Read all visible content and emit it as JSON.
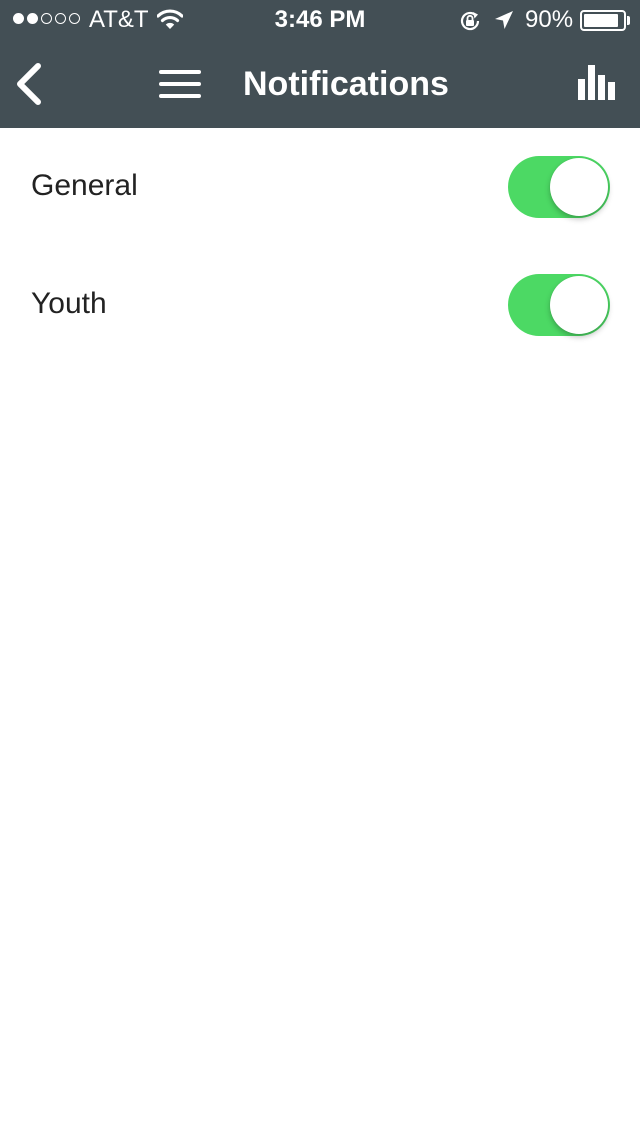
{
  "status_bar": {
    "carrier": "AT&T",
    "time": "3:46 PM",
    "battery_percent": "90%",
    "signal_bars_filled": 2,
    "signal_bars_total": 5
  },
  "nav": {
    "title": "Notifications",
    "back_icon": "chevron-left-icon",
    "menu_icon": "hamburger-menu-icon",
    "stats_icon": "bar-chart-icon"
  },
  "settings": [
    {
      "label": "General",
      "enabled": true
    },
    {
      "label": "Youth",
      "enabled": true
    }
  ],
  "colors": {
    "header_bg": "#434f55",
    "toggle_on": "#4cd964",
    "text": "#222222"
  }
}
